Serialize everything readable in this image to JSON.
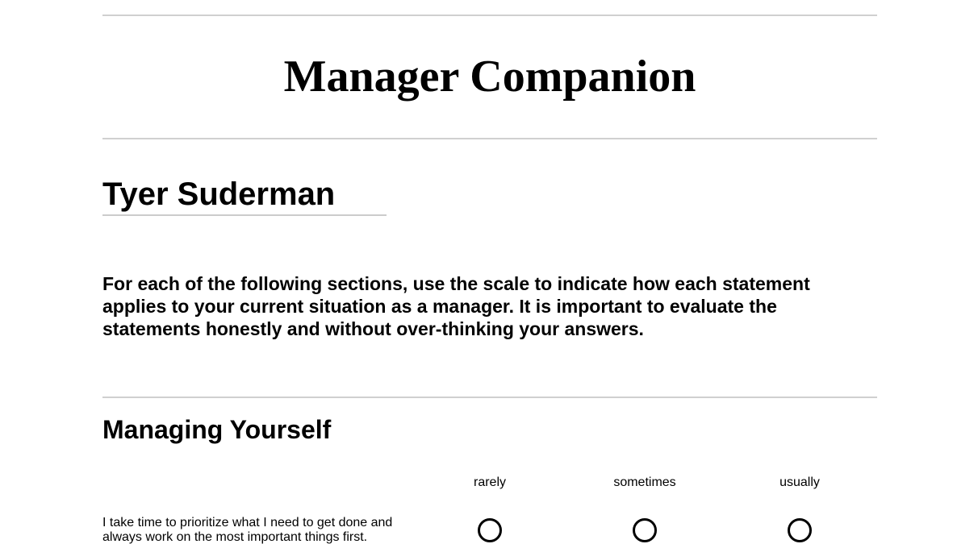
{
  "header": {
    "title": "Manager Companion"
  },
  "profile": {
    "name_value": "Tyer Suderman"
  },
  "instructions": {
    "text": "For each of the following sections, use the scale to indicate how each statement applies to your current situation as a manager. It is important to evaluate the statements honestly and without over-thinking your answers."
  },
  "sections": [
    {
      "title": "Managing Yourself",
      "scale": [
        "rarely",
        "sometimes",
        "usually"
      ],
      "statements": [
        {
          "text": "I take time to prioritize what I need to get done and always work on the most important things first.",
          "selected": null
        }
      ]
    }
  ],
  "colors": {
    "rule": "#d0d0d0",
    "text": "#000000",
    "background": "#ffffff"
  }
}
